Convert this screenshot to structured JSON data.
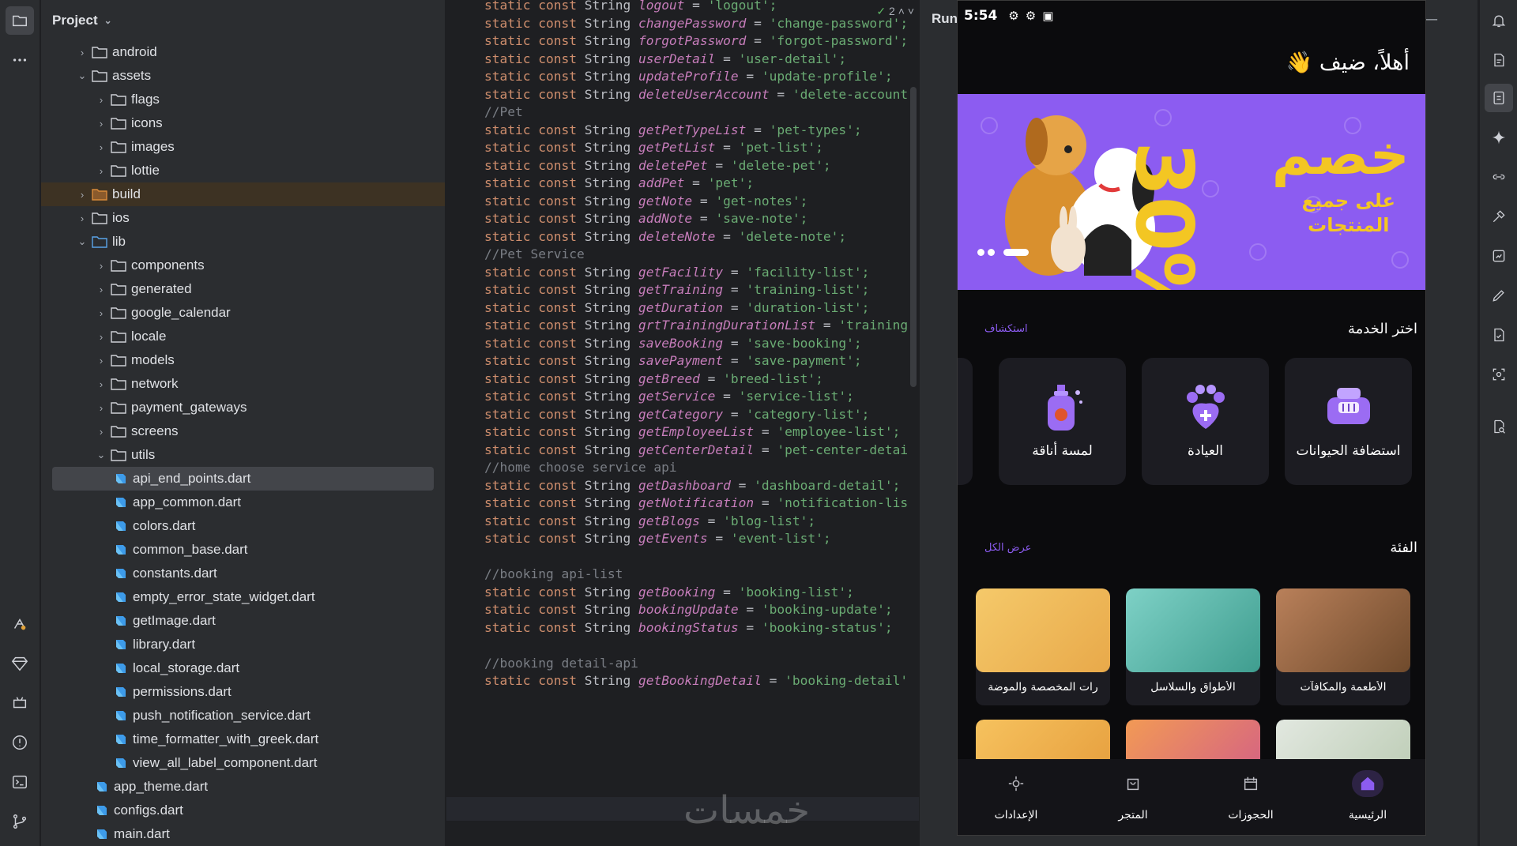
{
  "project_panel": {
    "title": "Project",
    "tree": [
      {
        "label": "android",
        "kind": "folder",
        "depth": 1,
        "expanded": false
      },
      {
        "label": "assets",
        "kind": "folder",
        "depth": 1,
        "expanded": true
      },
      {
        "label": "flags",
        "kind": "folder",
        "depth": 2,
        "expanded": false
      },
      {
        "label": "icons",
        "kind": "folder",
        "depth": 2,
        "expanded": false
      },
      {
        "label": "images",
        "kind": "folder",
        "depth": 2,
        "expanded": false
      },
      {
        "label": "lottie",
        "kind": "folder",
        "depth": 2,
        "expanded": false
      },
      {
        "label": "build",
        "kind": "folder-build",
        "depth": 1,
        "expanded": false
      },
      {
        "label": "ios",
        "kind": "folder",
        "depth": 1,
        "expanded": false
      },
      {
        "label": "lib",
        "kind": "folder-lib",
        "depth": 1,
        "expanded": true
      },
      {
        "label": "components",
        "kind": "folder",
        "depth": 2,
        "expanded": false
      },
      {
        "label": "generated",
        "kind": "folder",
        "depth": 2,
        "expanded": false
      },
      {
        "label": "google_calendar",
        "kind": "folder",
        "depth": 2,
        "expanded": false
      },
      {
        "label": "locale",
        "kind": "folder",
        "depth": 2,
        "expanded": false
      },
      {
        "label": "models",
        "kind": "folder",
        "depth": 2,
        "expanded": false
      },
      {
        "label": "network",
        "kind": "folder",
        "depth": 2,
        "expanded": false
      },
      {
        "label": "payment_gateways",
        "kind": "folder",
        "depth": 2,
        "expanded": false
      },
      {
        "label": "screens",
        "kind": "folder",
        "depth": 2,
        "expanded": false
      },
      {
        "label": "utils",
        "kind": "folder",
        "depth": 2,
        "expanded": true
      },
      {
        "label": "api_end_points.dart",
        "kind": "dart",
        "depth": 3,
        "selected": true
      },
      {
        "label": "app_common.dart",
        "kind": "dart",
        "depth": 3
      },
      {
        "label": "colors.dart",
        "kind": "dart",
        "depth": 3
      },
      {
        "label": "common_base.dart",
        "kind": "dart",
        "depth": 3
      },
      {
        "label": "constants.dart",
        "kind": "dart",
        "depth": 3
      },
      {
        "label": "empty_error_state_widget.dart",
        "kind": "dart",
        "depth": 3
      },
      {
        "label": "getImage.dart",
        "kind": "dart",
        "depth": 3
      },
      {
        "label": "library.dart",
        "kind": "dart",
        "depth": 3
      },
      {
        "label": "local_storage.dart",
        "kind": "dart",
        "depth": 3
      },
      {
        "label": "permissions.dart",
        "kind": "dart",
        "depth": 3
      },
      {
        "label": "push_notification_service.dart",
        "kind": "dart",
        "depth": 3
      },
      {
        "label": "time_formatter_with_greek.dart",
        "kind": "dart",
        "depth": 3
      },
      {
        "label": "view_all_label_component.dart",
        "kind": "dart",
        "depth": 3
      },
      {
        "label": "app_theme.dart",
        "kind": "dart",
        "depth": 2
      },
      {
        "label": "configs.dart",
        "kind": "dart",
        "depth": 2
      },
      {
        "label": "main.dart",
        "kind": "dart",
        "depth": 2
      }
    ]
  },
  "editor": {
    "inspection_count": "2",
    "lines": [
      {
        "type": "code",
        "name": "logout",
        "value": "'logout';"
      },
      {
        "type": "code",
        "name": "changePassword",
        "value": "'change-password';"
      },
      {
        "type": "code",
        "name": "forgotPassword",
        "value": "'forgot-password';"
      },
      {
        "type": "code",
        "name": "userDetail",
        "value": "'user-detail';"
      },
      {
        "type": "code",
        "name": "updateProfile",
        "value": "'update-profile';"
      },
      {
        "type": "code",
        "name": "deleteUserAccount",
        "value": "'delete-account"
      },
      {
        "type": "comment",
        "text": "//Pet"
      },
      {
        "type": "code",
        "name": "getPetTypeList",
        "value": "'pet-types';"
      },
      {
        "type": "code",
        "name": "getPetList",
        "value": "'pet-list';"
      },
      {
        "type": "code",
        "name": "deletePet",
        "value": "'delete-pet';"
      },
      {
        "type": "code",
        "name": "addPet",
        "value": "'pet';"
      },
      {
        "type": "code",
        "name": "getNote",
        "value": "'get-notes';"
      },
      {
        "type": "code",
        "name": "addNote",
        "value": "'save-note';"
      },
      {
        "type": "code",
        "name": "deleteNote",
        "value": "'delete-note';"
      },
      {
        "type": "comment",
        "text": "//Pet Service"
      },
      {
        "type": "code",
        "name": "getFacility",
        "value": "'facility-list';"
      },
      {
        "type": "code",
        "name": "getTraining",
        "value": "'training-list';"
      },
      {
        "type": "code",
        "name": "getDuration",
        "value": "'duration-list';"
      },
      {
        "type": "code",
        "name": "grtTrainingDurationList",
        "value": "'training"
      },
      {
        "type": "code",
        "name": "saveBooking",
        "value": "'save-booking';"
      },
      {
        "type": "code",
        "name": "savePayment",
        "value": "'save-payment';"
      },
      {
        "type": "code",
        "name": "getBreed",
        "value": "'breed-list';"
      },
      {
        "type": "code",
        "name": "getService",
        "value": "'service-list';"
      },
      {
        "type": "code",
        "name": "getCategory",
        "value": "'category-list';"
      },
      {
        "type": "code",
        "name": "getEmployeeList",
        "value": "'employee-list';"
      },
      {
        "type": "code",
        "name": "getCenterDetail",
        "value": "'pet-center-detai"
      },
      {
        "type": "comment",
        "text": "//home choose service api"
      },
      {
        "type": "code",
        "name": "getDashboard",
        "value": "'dashboard-detail';"
      },
      {
        "type": "code",
        "name": "getNotification",
        "value": "'notification-lis"
      },
      {
        "type": "code",
        "name": "getBlogs",
        "value": "'blog-list';"
      },
      {
        "type": "code",
        "name": "getEvents",
        "value": "'event-list';"
      },
      {
        "type": "blank"
      },
      {
        "type": "comment",
        "text": "//booking api-list"
      },
      {
        "type": "code",
        "name": "getBooking",
        "value": "'booking-list';"
      },
      {
        "type": "code",
        "name": "bookingUpdate",
        "value": "'booking-update';"
      },
      {
        "type": "code",
        "name": "bookingStatus",
        "value": "'booking-status';"
      },
      {
        "type": "blank"
      },
      {
        "type": "comment",
        "text": "//booking detail-api"
      },
      {
        "type": "code",
        "name": "getBookingDetail",
        "value": "'booking-detail'"
      }
    ],
    "keyword_static": "static",
    "keyword_const": "const",
    "type_string": "String",
    "watermark": "خمسات"
  },
  "run_panel": {
    "title": "Run"
  },
  "phone": {
    "status_time": "5:54",
    "greeting": "أهلاً، ضيف 👋",
    "banner": {
      "percent": "30%",
      "discount": "خصم",
      "subtitle_line1": "على جميع",
      "subtitle_line2": "المنتجات"
    },
    "services_section": {
      "title": "اختر الخدمة",
      "link": "استكشاف",
      "items": [
        {
          "label": "استضافة الحيوانات",
          "icon": "pet-carrier-icon"
        },
        {
          "label": "العيادة",
          "icon": "clinic-paw-icon"
        },
        {
          "label": "لمسة أناقة",
          "icon": "grooming-bottle-icon"
        }
      ]
    },
    "category_section": {
      "title": "الفئة",
      "link": "عرض الكل",
      "items": [
        {
          "label": "الأطعمة والمكافآت",
          "colors": [
            "#b9805a",
            "#6f4a2c"
          ]
        },
        {
          "label": "الأطواق والسلاسل",
          "colors": [
            "#7ed1c6",
            "#3f9d8f"
          ]
        },
        {
          "label": "رات المخصصة والموضة",
          "colors": [
            "#f5c96a",
            "#e8a94a"
          ]
        },
        {
          "label": "",
          "colors": [
            "#e2e8e0",
            "#b8c9b0"
          ]
        },
        {
          "label": "",
          "colors": [
            "#f29a55",
            "#d05a8a"
          ]
        },
        {
          "label": "",
          "colors": [
            "#f6c25e",
            "#e49a3a"
          ]
        }
      ]
    },
    "bottom_nav": [
      {
        "label": "الرئيسية",
        "icon": "home-icon",
        "active": true
      },
      {
        "label": "الحجوزات",
        "icon": "calendar-icon",
        "active": false
      },
      {
        "label": "المتجر",
        "icon": "shopping-bag-icon",
        "active": false
      },
      {
        "label": "الإعدادات",
        "icon": "settings-icon",
        "active": false
      }
    ],
    "accent_color": "#8c5cf1",
    "banner_color": "#8c5cf1",
    "banner_text_color": "#f3c623"
  }
}
